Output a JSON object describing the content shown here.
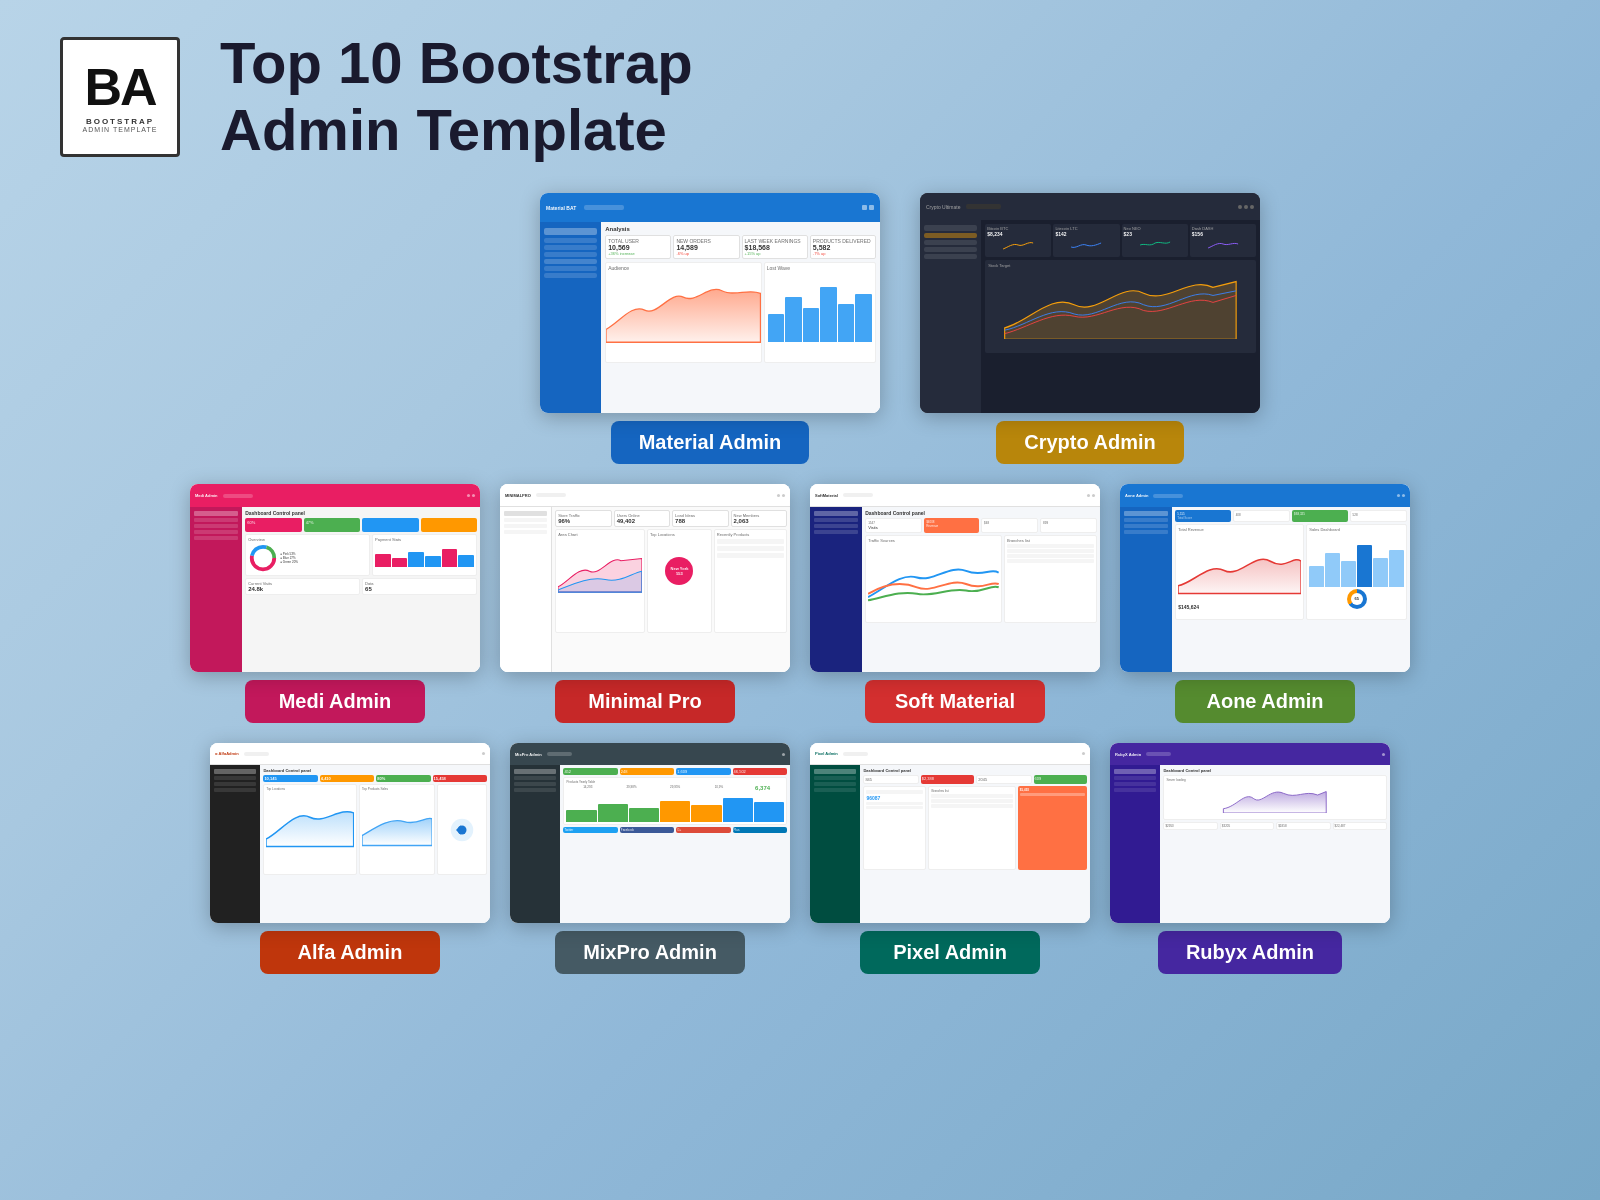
{
  "header": {
    "logo_letters": "BA",
    "logo_text": "BOOTSTRAP",
    "logo_sub": "ADMIN TEMPLATE",
    "title_line1": "Top 10 Bootstrap",
    "title_line2": "Admin Template"
  },
  "templates": {
    "row1": [
      {
        "id": "material-admin",
        "label": "Material Admin",
        "label_color": "label-blue",
        "size": "large"
      },
      {
        "id": "crypto-admin",
        "label": "Crypto Admin",
        "label_color": "label-gold",
        "size": "large"
      }
    ],
    "row2": [
      {
        "id": "medi-admin",
        "label": "Medi Admin",
        "label_color": "label-pink",
        "size": "medium"
      },
      {
        "id": "minimal-pro",
        "label": "Minimal Pro",
        "label_color": "label-red",
        "size": "medium"
      },
      {
        "id": "soft-material",
        "label": "Soft Material",
        "label_color": "label-red2",
        "size": "medium"
      },
      {
        "id": "aone-admin",
        "label": "Aone Admin",
        "label_color": "label-olive",
        "size": "medium"
      }
    ],
    "row3": [
      {
        "id": "alfa-admin",
        "label": "Alfa Admin",
        "label_color": "label-orange",
        "size": "small"
      },
      {
        "id": "mixpro-admin",
        "label": "MixPro Admin",
        "label_color": "label-slate",
        "size": "small"
      },
      {
        "id": "pixel-admin",
        "label": "Pixel Admin",
        "label_color": "label-teal",
        "size": "small"
      },
      {
        "id": "rubyx-admin",
        "label": "Rubyx Admin",
        "label_color": "label-purple",
        "size": "small"
      }
    ]
  }
}
